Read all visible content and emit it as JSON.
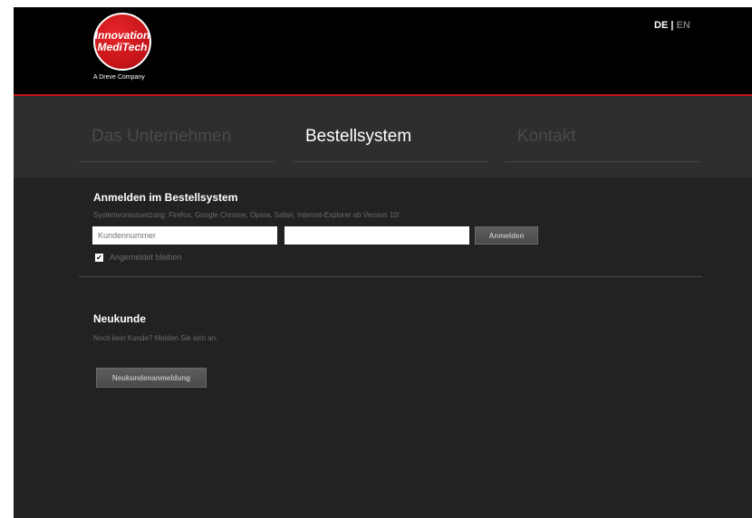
{
  "header": {
    "logo_line1": "Innovation",
    "logo_line2": "MediTech",
    "tagline": "A Dreve Company",
    "lang_de": "DE",
    "lang_sep": "|",
    "lang_en": "EN"
  },
  "nav": {
    "items": [
      {
        "label": "Das Unternehmen"
      },
      {
        "label": "Bestellsystem"
      },
      {
        "label": "Kontakt"
      }
    ],
    "active": "Bestellsystem"
  },
  "login": {
    "title": "Anmelden im Bestellsystem",
    "requirements": "Systemvoraussetzung: Firefox, Google Chrome, Opera, Safari, Internet-Explorer ab Version 10!",
    "customer_placeholder": "Kundennummer",
    "customer_value": "",
    "password_value": "",
    "button_label": "Anmelden",
    "remember_label": "Angemeldet bleiben",
    "remember_checked": "✔"
  },
  "new_customer": {
    "title": "Neukunde",
    "text": "Noch kein Kunde? Melden Sie sich an.",
    "button_label": "Neukundenanmeldung"
  },
  "colors": {
    "accent": "#c41418",
    "background": "#222222",
    "header": "#000000"
  }
}
